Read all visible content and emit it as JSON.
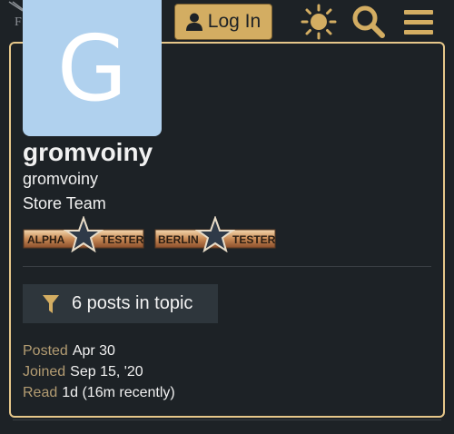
{
  "header": {
    "login_label": "Log In",
    "icons": [
      "sun-icon",
      "search-icon",
      "hamburger-menu-icon"
    ]
  },
  "user": {
    "avatar_letter": "G",
    "username": "gromvoiny",
    "name": "gromvoiny",
    "title": "Store Team",
    "badges": [
      {
        "left": "ALPHA",
        "right": "TESTER"
      },
      {
        "left": "BERLIN",
        "right": "TESTER"
      }
    ]
  },
  "posts_button_label": "6 posts in topic",
  "stats": [
    {
      "label": "Posted",
      "value": "Apr 30"
    },
    {
      "label": "Joined",
      "value": "Sep 15, '20"
    },
    {
      "label": "Read",
      "value": "1d (16m recently)"
    }
  ],
  "colors": {
    "accent": "#d3ad62",
    "avatar_bg": "#b0d1ee",
    "background": "#1d2226",
    "muted_label": "#b39c72"
  }
}
